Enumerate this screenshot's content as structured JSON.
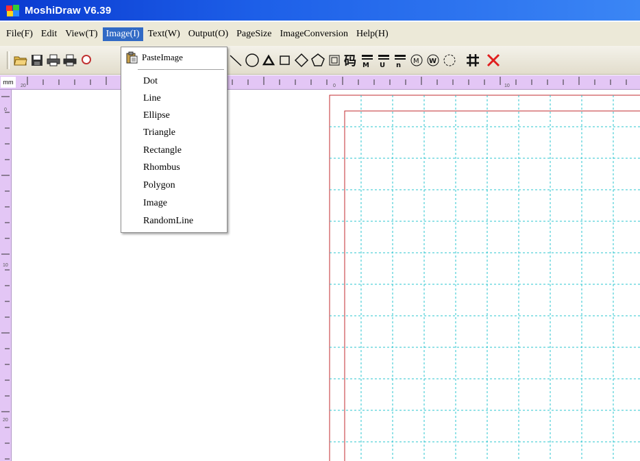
{
  "window": {
    "title": "MoshiDraw V6.39"
  },
  "menubar": {
    "items": [
      {
        "label": "File(F)",
        "name": "menu-file"
      },
      {
        "label": "Edit",
        "name": "menu-edit"
      },
      {
        "label": "View(T)",
        "name": "menu-view"
      },
      {
        "label": "Image(I)",
        "name": "menu-image",
        "active": true
      },
      {
        "label": "Text(W)",
        "name": "menu-text"
      },
      {
        "label": "Output(O)",
        "name": "menu-output"
      },
      {
        "label": "PageSize",
        "name": "menu-pagesize"
      },
      {
        "label": "ImageConversion",
        "name": "menu-imageconversion"
      },
      {
        "label": "Help(H)",
        "name": "menu-help"
      }
    ]
  },
  "image_menu": {
    "paste_label": "PasteImage",
    "items": [
      "Dot",
      "Line",
      "Ellipse",
      "Triangle",
      "Rectangle",
      "Rhombus",
      "Polygon",
      "Image",
      "RandomLine"
    ]
  },
  "toolbar": {
    "icons": [
      "open-folder-icon",
      "save-disk-icon",
      "print-icon",
      "print-preview-icon",
      "zoom-icon",
      "filled-square-icon",
      "diagonal-line-icon",
      "circle-icon",
      "triangle-icon",
      "square-icon",
      "rhombus-icon",
      "pentagon-icon",
      "image-box-icon",
      "barcode-char-icon",
      "text-align-m-icon",
      "text-align-u-icon",
      "text-align-n-icon",
      "circle-m-icon",
      "circle-w-icon",
      "dashed-circle-icon",
      "grid-hash-icon",
      "delete-x-icon"
    ]
  },
  "ruler": {
    "unit": "mm",
    "h_labels": [
      "20",
      "0",
      "10"
    ],
    "v_labels": [
      "0",
      "10",
      "20"
    ]
  },
  "colors": {
    "titlebar": "#0a3ad0",
    "ruler": "#e3c6f5",
    "grid_line": "#27c4cf",
    "page_border": "#c0282d",
    "menu_highlight": "#316ac5"
  }
}
